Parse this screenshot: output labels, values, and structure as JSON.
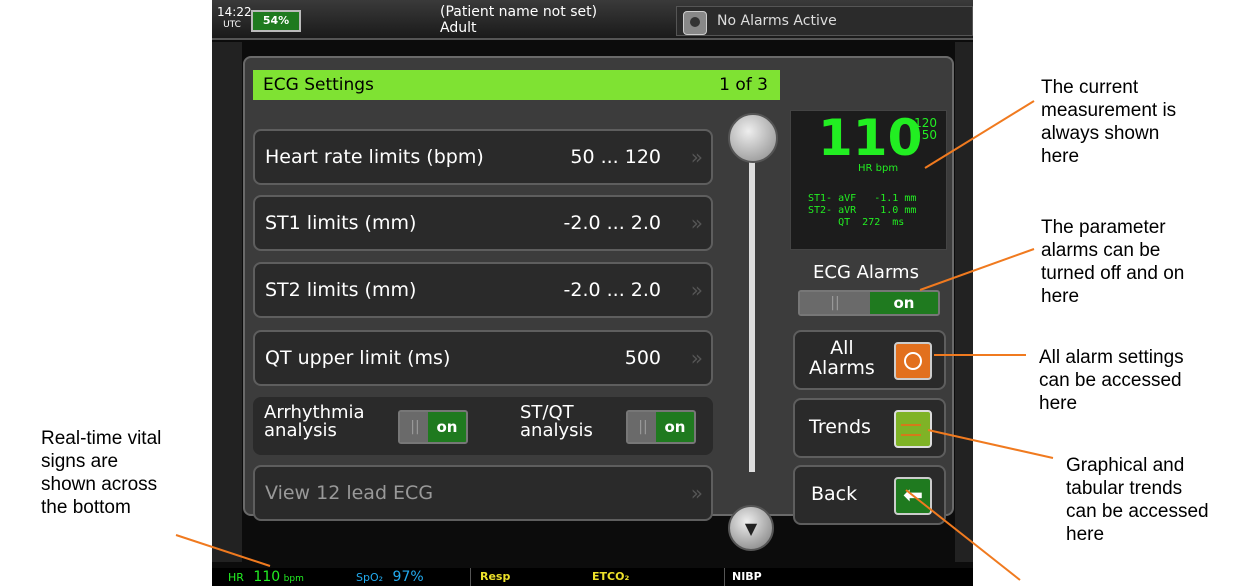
{
  "status": {
    "time": "14:22",
    "utc": "UTC",
    "battery": "54%",
    "patient_name": "(Patient name not set)",
    "patient_type": "Adult",
    "alarm_status": "No Alarms Active"
  },
  "dialog": {
    "title": "ECG Settings",
    "page": "1 of 3",
    "rows": [
      {
        "label": "Heart rate limits (bpm)",
        "value": "50 ... 120"
      },
      {
        "label": "ST1  limits (mm)",
        "value": "-2.0 ... 2.0"
      },
      {
        "label": "ST2  limits (mm)",
        "value": "-2.0 ... 2.0"
      },
      {
        "label": "QT upper limit (ms)",
        "value": "500"
      },
      {
        "label": "View 12 lead ECG",
        "value": ""
      }
    ],
    "toggles": [
      {
        "label_1": "Arrhythmia",
        "label_2": "analysis",
        "off": "||",
        "on": "on"
      },
      {
        "label_1": "ST/QT",
        "label_2": "analysis",
        "off": "||",
        "on": "on"
      }
    ]
  },
  "measurement": {
    "hr": "110",
    "upper": "120",
    "lower": "50",
    "unit": "HR bpm",
    "st": "ST1- aVF   -1.1 mm\nST2- aVR    1.0 mm\n     QT  272  ms"
  },
  "ecg_alarms": {
    "label": "ECG Alarms",
    "off": "||",
    "on": "on"
  },
  "buttons": {
    "all_alarms_1": "All",
    "all_alarms_2": "Alarms",
    "trends": "Trends",
    "back": "Back"
  },
  "bottom": {
    "hr_label": "HR",
    "hr_value": "110",
    "hr_unit": "bpm",
    "spo2_label": "SpO₂",
    "spo2_value": "97%",
    "resp": "Resp",
    "etco2": "ETCO₂",
    "nibp": "NIBP"
  },
  "annotations": {
    "current_measurement": "The current\nmeasurement is\nalways shown\nhere",
    "parameter_alarms": "The parameter\nalarms can be\nturned off and on\nhere",
    "all_alarm_settings": "All alarm settings\ncan be accessed\nhere",
    "trends": "Graphical and\ntabular trends\ncan be accessed\nhere",
    "vital_signs": "Real-time vital\nsigns are\nshown across\nthe bottom"
  },
  "colors": {
    "accent": "#7fe233",
    "vital_green": "#22ee22",
    "annotation_line": "#f07a1f"
  }
}
